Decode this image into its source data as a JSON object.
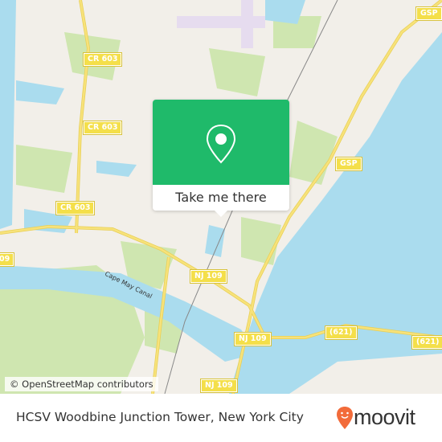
{
  "map": {
    "colors": {
      "land": "#f2efe9",
      "water": "#aadcee",
      "park": "#cfe6b0",
      "road": "#f7e27a",
      "accent": "#1fba6a",
      "brand": "#f26b3a"
    },
    "labels": {
      "cr603_a": "CR 603",
      "cr603_b": "CR 603",
      "cr603_c": "CR 603",
      "gsp_a": "GSP",
      "gsp_b": "GSP",
      "nj109_a": "NJ 109",
      "nj109_b": "NJ 109",
      "nj109_c": "NJ 109",
      "r621_a": "(621)",
      "r621_b": "(621)",
      "r09": "09",
      "canal": "Cape May Canal"
    },
    "attribution": "© OpenStreetMap contributors"
  },
  "popup": {
    "icon": "map-pin-icon",
    "button_label": "Take me there"
  },
  "footer": {
    "title": "HCSV Woodbine Junction Tower, New York City",
    "logo_text": "moovit"
  }
}
